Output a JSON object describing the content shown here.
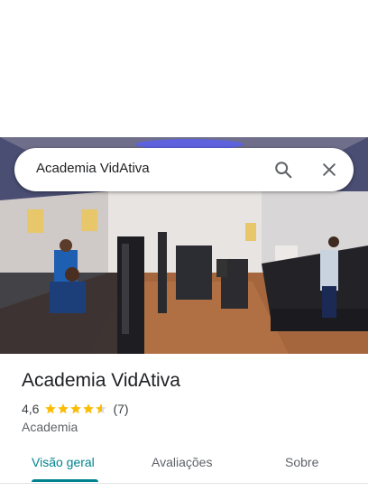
{
  "search": {
    "query": "Academia VidAtiva"
  },
  "place": {
    "name": "Academia VidAtiva",
    "rating": "4,6",
    "stars": 4.6,
    "review_count": "(7)",
    "category": "Academia"
  },
  "tabs": [
    {
      "label": "Visão geral",
      "active": true
    },
    {
      "label": "Avaliações",
      "active": false
    },
    {
      "label": "Sobre",
      "active": false
    }
  ],
  "colors": {
    "star": "#fbbc04",
    "accent": "#00838f"
  },
  "icons": {
    "search": "search-icon",
    "close": "close-icon",
    "star": "star-icon"
  }
}
